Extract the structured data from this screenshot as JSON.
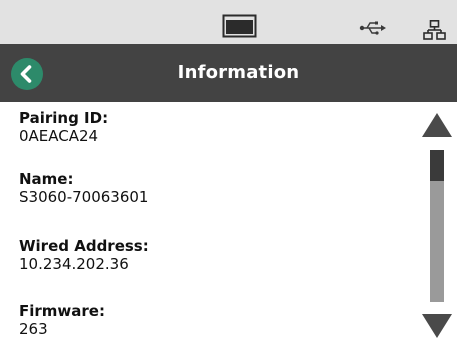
{
  "status_bar": {
    "icons": [
      "display-icon",
      "usb-icon",
      "network-icon"
    ]
  },
  "header": {
    "back_icon": "chevron-left-icon",
    "title": "Information",
    "back_color": "#2d8a6a"
  },
  "info": [
    {
      "label": "Pairing ID:",
      "value": "0AEACA24"
    },
    {
      "label": "Name:",
      "value": "S3060-70063601"
    },
    {
      "label": "Wired Address:",
      "value": "10.234.202.36"
    },
    {
      "label": "Firmware:",
      "value": "263"
    }
  ],
  "scrollbar": {
    "up_icon": "triangle-up-icon",
    "down_icon": "triangle-down-icon",
    "scroll_position": 0
  }
}
